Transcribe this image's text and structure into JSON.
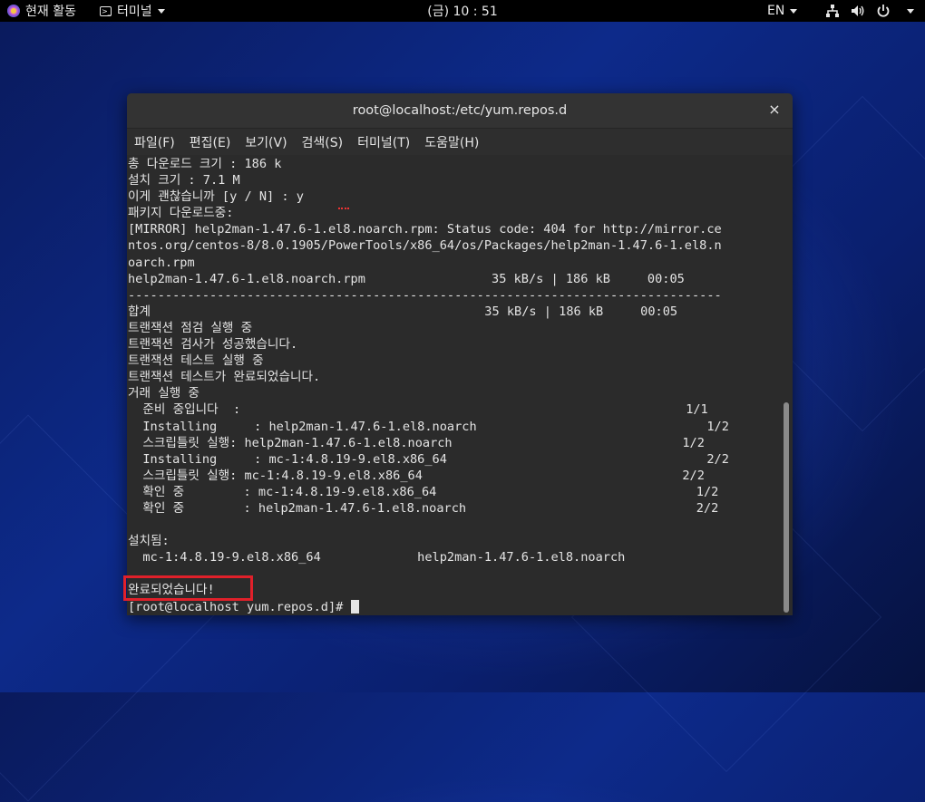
{
  "topbar": {
    "activities": "현재 활동",
    "app_menu": "터미널",
    "clock": "(금) 10 : 51",
    "language": "EN",
    "icons": [
      "network-icon",
      "volume-icon",
      "power-icon"
    ]
  },
  "window": {
    "title": "root@localhost:/etc/yum.repos.d",
    "close": "×",
    "menu": [
      "파일(F)",
      "편집(E)",
      "보기(V)",
      "검색(S)",
      "터미널(T)",
      "도움말(H)"
    ]
  },
  "terminal": {
    "lines": [
      "총 다운로드 크기 : 186 k",
      "설치 크기 : 7.1 M",
      "이게 괜찮습니까 [y / N] : y",
      "패키지 다운로드중:",
      "[MIRROR] help2man-1.47.6-1.el8.noarch.rpm: Status code: 404 for http://mirror.ce",
      "ntos.org/centos-8/8.0.1905/PowerTools/x86_64/os/Packages/help2man-1.47.6-1.el8.n",
      "oarch.rpm",
      "help2man-1.47.6-1.el8.noarch.rpm                 35 kB/s | 186 kB     00:05",
      "--------------------------------------------------------------------------------",
      "합계                                             35 kB/s | 186 kB     00:05",
      "트랜잭션 점검 실행 중",
      "트랜잭션 검사가 성공했습니다.",
      "트랜잭션 테스트 실행 중",
      "트랜잭션 테스트가 완료되었습니다.",
      "거래 실행 중",
      "  준비 중입니다  :                                                            1/1",
      "  Installing     : help2man-1.47.6-1.el8.noarch                               1/2",
      "  스크립틀릿 실행: help2man-1.47.6-1.el8.noarch                               1/2",
      "  Installing     : mc-1:4.8.19-9.el8.x86_64                                   2/2",
      "  스크립틀릿 실행: mc-1:4.8.19-9.el8.x86_64                                   2/2",
      "  확인 중        : mc-1:4.8.19-9.el8.x86_64                                   1/2",
      "  확인 중        : help2man-1.47.6-1.el8.noarch                               2/2",
      "",
      "설치됨:",
      "  mc-1:4.8.19-9.el8.x86_64             help2man-1.47.6-1.el8.noarch",
      "",
      "완료되었습니다!"
    ],
    "prompt": "[root@localhost yum.repos.d]# "
  }
}
